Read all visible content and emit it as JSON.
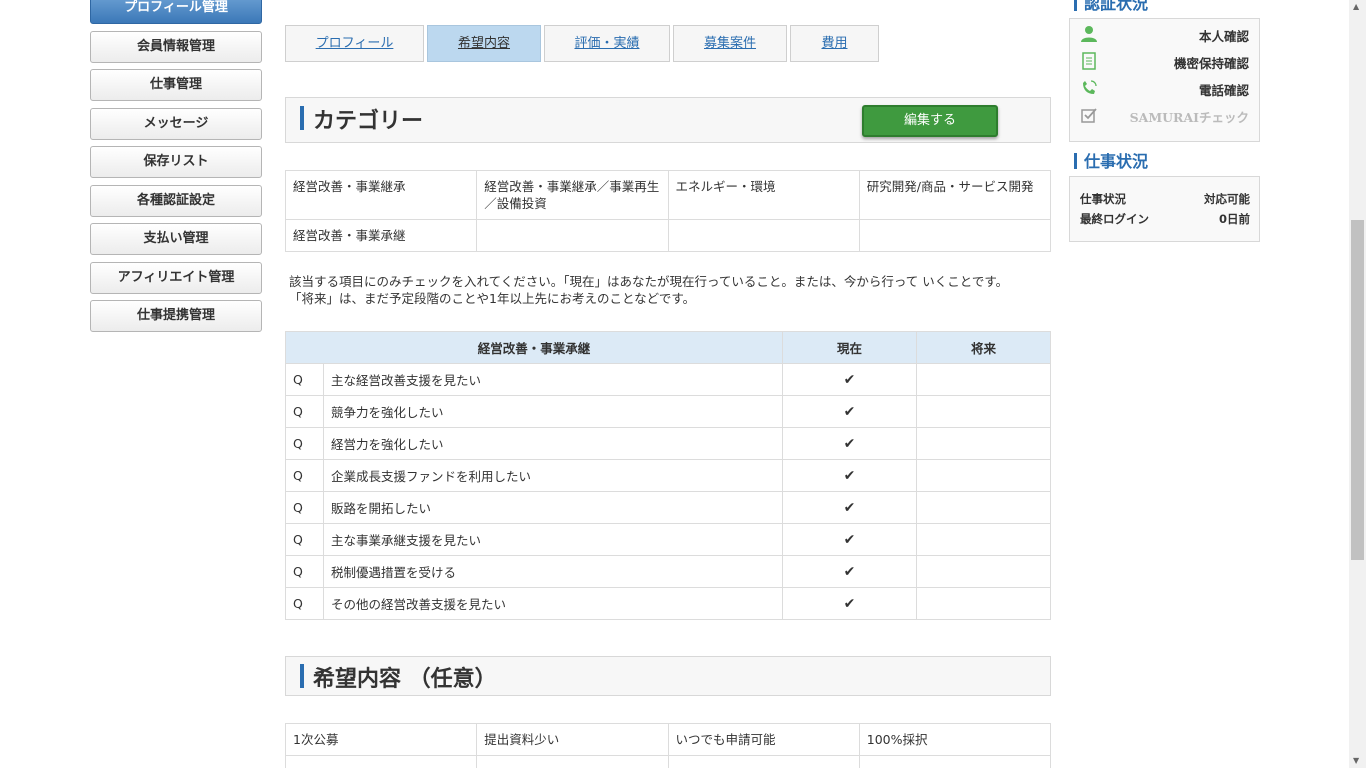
{
  "sidebar": {
    "items": [
      {
        "label": "プロフィール管理",
        "active": true
      },
      {
        "label": "会員情報管理"
      },
      {
        "label": "仕事管理"
      },
      {
        "label": "メッセージ"
      },
      {
        "label": "保存リスト"
      },
      {
        "label": "各種認証設定"
      },
      {
        "label": "支払い管理"
      },
      {
        "label": "アフィリエイト管理"
      },
      {
        "label": "仕事提携管理"
      }
    ]
  },
  "tabs": [
    {
      "label": "プロフィール"
    },
    {
      "label": "希望内容",
      "active": true
    },
    {
      "label": "評価・実績"
    },
    {
      "label": "募集案件"
    },
    {
      "label": "費用"
    }
  ],
  "category": {
    "title": "カテゴリー",
    "edit_label": "編集する",
    "rows": [
      [
        "経営改善・事業継承",
        "経営改善・事業継承／事業再生／設備投資",
        "エネルギー・環境",
        "研究開発/商品・サービス開発"
      ],
      [
        "経営改善・事業承継",
        "",
        "",
        ""
      ]
    ],
    "note_line1": "該当する項目にのみチェックを入れてください。「現在」はあなたが現在行っていること。または、今から行って いくことです。",
    "note_line2": "「将来」は、まだ予定段階のことや1年以上先にお考えのことなどです。"
  },
  "questions": {
    "header": "経営改善・事業承継",
    "col_now": "現在",
    "col_future": "将来",
    "q_prefix": "Q",
    "check_glyph": "✔",
    "rows": [
      {
        "label": "主な経営改善支援を見たい",
        "now": true,
        "future": false
      },
      {
        "label": "競争力を強化したい",
        "now": true,
        "future": false
      },
      {
        "label": "経営力を強化したい",
        "now": true,
        "future": false
      },
      {
        "label": "企業成長支援ファンドを利用したい",
        "now": true,
        "future": false
      },
      {
        "label": "販路を開拓したい",
        "now": true,
        "future": false
      },
      {
        "label": "主な事業承継支援を見たい",
        "now": true,
        "future": false
      },
      {
        "label": "税制優遇措置を受ける",
        "now": true,
        "future": false
      },
      {
        "label": "その他の経営改善支援を見たい",
        "now": true,
        "future": false
      }
    ]
  },
  "wishes": {
    "title": "希望内容 （任意）",
    "rows": [
      [
        "1次公募",
        "提出資料少い",
        "いつでも申請可能",
        "100%採択"
      ]
    ]
  },
  "right": {
    "cert_title": "認証状況",
    "cert_items": [
      {
        "label": "本人確認",
        "icon": "person-icon",
        "color": "#5cb85c"
      },
      {
        "label": "機密保持確認",
        "icon": "document-icon",
        "color": "#5cb85c"
      },
      {
        "label": "電話確認",
        "icon": "phone-icon",
        "color": "#5cb85c"
      },
      {
        "label": "SAMURAIチェック",
        "icon": "checkbox-icon",
        "color": "#999999",
        "dim": true
      }
    ],
    "work_title": "仕事状況",
    "work_rows": [
      {
        "label": "仕事状況",
        "value": "対応可能"
      },
      {
        "label": "最終ログイン",
        "value": "0日前"
      }
    ]
  },
  "colors": {
    "accent": "#2a6db0",
    "edit_button": "#3f9a3f",
    "active_tab": "#bcd8ef"
  }
}
